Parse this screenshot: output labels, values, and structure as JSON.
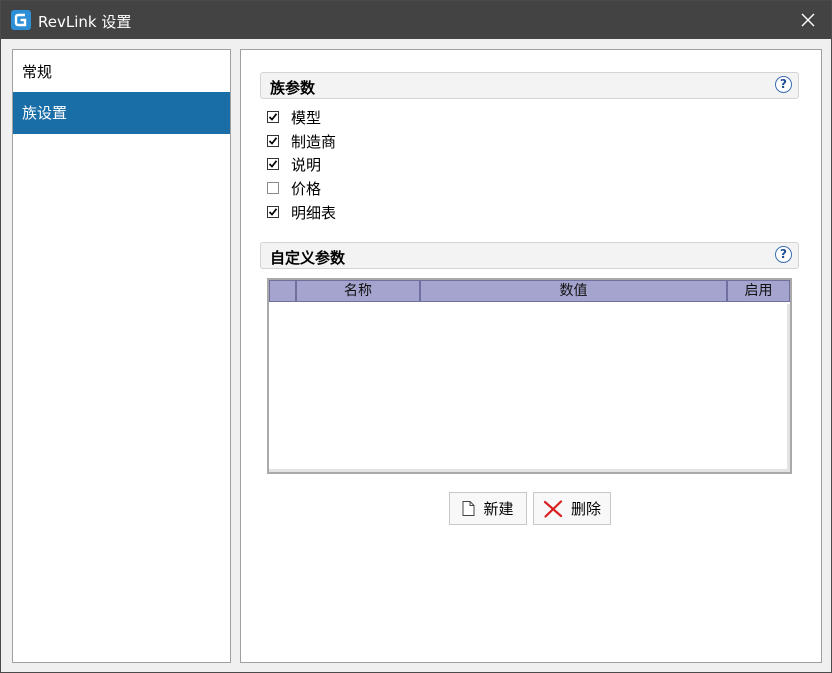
{
  "window": {
    "title": "RevLink 设置",
    "app_icon": "revlink-logo-icon",
    "close_icon": "close-icon"
  },
  "sidebar": {
    "items": [
      {
        "label": "常规",
        "active": false
      },
      {
        "label": "族设置",
        "active": true
      }
    ]
  },
  "family_params": {
    "title": "族参数",
    "help_icon": "?",
    "options": [
      {
        "label": "模型",
        "checked": true
      },
      {
        "label": "制造商",
        "checked": true
      },
      {
        "label": "说明",
        "checked": true
      },
      {
        "label": "价格",
        "checked": false
      },
      {
        "label": "明细表",
        "checked": true
      }
    ]
  },
  "custom_params": {
    "title": "自定义参数",
    "help_icon": "?",
    "columns": [
      "名称",
      "数值",
      "启用"
    ],
    "rows": []
  },
  "buttons": {
    "new_label": "新建",
    "new_icon": "new-document-icon",
    "delete_label": "删除",
    "delete_icon": "delete-x-icon"
  },
  "colors": {
    "title_bar": "#434343",
    "selected_item": "#1a6ea8",
    "grid_header": "#a4a4cf"
  }
}
